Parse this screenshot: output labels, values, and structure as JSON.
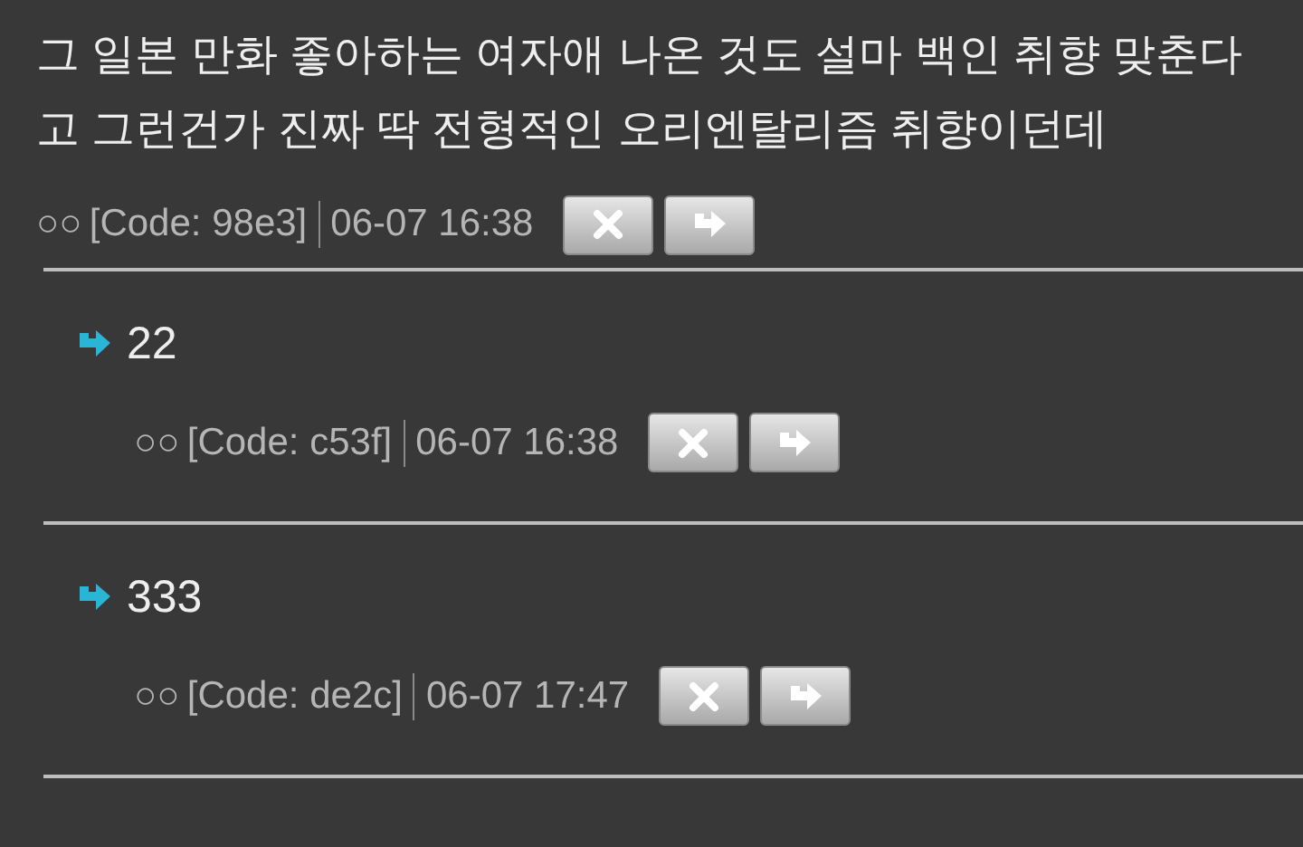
{
  "post": {
    "body": "그 일본 만화 좋아하는 여자애 나온 것도 설마 백인 취향 맞춘다고 그런건가 진짜 딱 전형적인 오리엔탈리즘 취향이던데",
    "author": "○○",
    "code": "[Code: 98e3]",
    "time": "06-07 16:38"
  },
  "replies": [
    {
      "body": "22",
      "author": "○○",
      "code": "[Code: c53f]",
      "time": "06-07 16:38"
    },
    {
      "body": "333",
      "author": "○○",
      "code": "[Code: de2c]",
      "time": "06-07 17:47"
    }
  ]
}
